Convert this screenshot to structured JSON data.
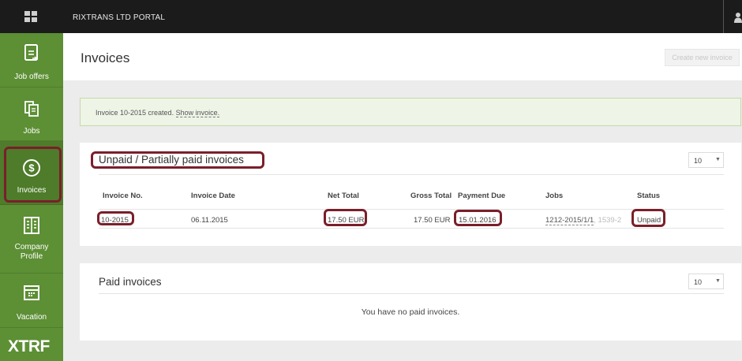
{
  "portal": {
    "title": "RIXTRANS LTD PORTAL"
  },
  "sidebar": {
    "items": [
      {
        "label": "Job offers",
        "icon": "document-arrow-icon"
      },
      {
        "label": "Jobs",
        "icon": "documents-icon"
      },
      {
        "label": "Invoices",
        "icon": "dollar-circle-icon"
      },
      {
        "label": "Company Profile",
        "icon": "building-icon"
      },
      {
        "label": "Vacation",
        "icon": "calendar-icon"
      }
    ],
    "logo": "XTRF"
  },
  "page": {
    "title": "Invoices",
    "create_label": "Create new invoice"
  },
  "alert": {
    "text": "Invoice 10-2015 created.",
    "link": "Show invoice."
  },
  "unpaid": {
    "title": "Unpaid / Partially paid invoices",
    "page_size": "10",
    "columns": [
      "Invoice No.",
      "Invoice Date",
      "Net Total",
      "Gross Total",
      "Payment Due",
      "Jobs",
      "Status"
    ],
    "rows": [
      {
        "invoice_no": "10-2015",
        "invoice_date": "06.11.2015",
        "net_total": "17.50 EUR",
        "gross_total": "17.50 EUR",
        "payment_due": "15.01.2016",
        "jobs": "1212-2015/1/1",
        "jobs_more": ", 1539-2",
        "status": "Unpaid"
      }
    ]
  },
  "paid": {
    "title": "Paid invoices",
    "page_size": "10",
    "empty_message": "You have no paid invoices."
  },
  "colors": {
    "sidebar": "#5d8f35",
    "topbar": "#1b1b1b",
    "highlight": "#7a1f2b"
  }
}
